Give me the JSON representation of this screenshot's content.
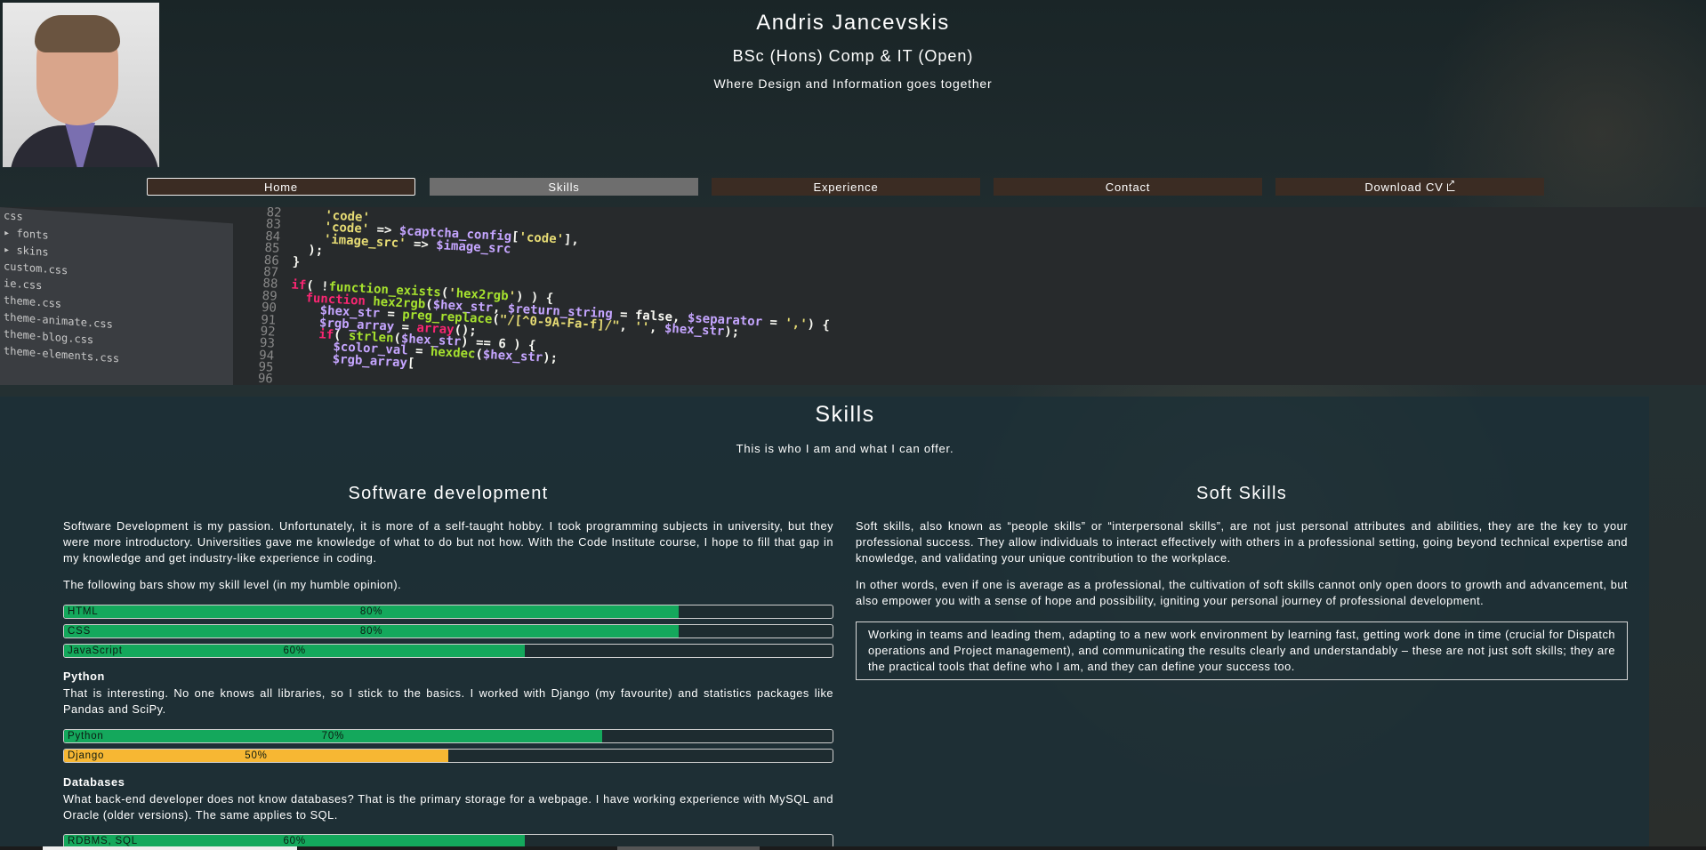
{
  "header": {
    "name": "Andris Jancevskis",
    "degree": "BSc (Hons) Comp & IT (Open)",
    "tagline": "Where Design and Information goes together"
  },
  "nav": {
    "items": [
      {
        "label": "Home"
      },
      {
        "label": "Skills"
      },
      {
        "label": "Experience"
      },
      {
        "label": "Contact"
      },
      {
        "label": "Download CV"
      }
    ],
    "download_icon": "external-link-icon"
  },
  "banner": {
    "tree": [
      "css",
      "▸ fonts",
      "▸ skins",
      "custom.css",
      "ie.css",
      "theme.css",
      "theme-animate.css",
      "theme-blog.css",
      "theme-elements.css"
    ],
    "code": [
      {
        "ln": "82",
        "text": "    'code'  "
      },
      {
        "ln": "83",
        "text": "    'code' => $captcha_config['code'],"
      },
      {
        "ln": "84",
        "text": "    'image_src' => $image_src"
      },
      {
        "ln": "85",
        "text": "  );"
      },
      {
        "ln": "86",
        "text": "}"
      },
      {
        "ln": "87",
        "text": ""
      },
      {
        "ln": "88",
        "text": "if( !function_exists('hex2rgb') ) {"
      },
      {
        "ln": "89",
        "text": "  function hex2rgb($hex_str, $return_string = false, $separator = ',') {"
      },
      {
        "ln": "90",
        "text": "    $hex_str = preg_replace(\"/[^0-9A-Fa-f]/\", '', $hex_str);"
      },
      {
        "ln": "91",
        "text": "    $rgb_array = array();"
      },
      {
        "ln": "92",
        "text": "    if( strlen($hex_str) == 6 ) {"
      },
      {
        "ln": "93",
        "text": "      $color_val = hexdec($hex_str);"
      },
      {
        "ln": "94",
        "text": "      $rgb_array["
      },
      {
        "ln": "95",
        "text": ""
      },
      {
        "ln": "96",
        "text": ""
      }
    ]
  },
  "skills": {
    "title": "Skills",
    "subtitle": "This is who I am and what I can offer.",
    "software": {
      "title": "Software development",
      "intro": "Software Development is my passion. Unfortunately, it is more of a self-taught hobby. I took programming subjects in university, but they were more introductory. Universities gave me knowledge of what to do but not how. With the Code Institute course, I hope to fill that gap in my knowledge and get industry-like experience in coding.",
      "bars_note": "The following bars show my skill level (in my humble opinion).",
      "bars": [
        {
          "label": "HTML",
          "percent_text": "80%",
          "value": 0.8,
          "color": "#14a85c"
        },
        {
          "label": "CSS",
          "percent_text": "80%",
          "value": 0.8,
          "color": "#14a85c"
        },
        {
          "label": "JavaScript",
          "percent_text": "60%",
          "value": 0.6,
          "color": "#14a85c"
        }
      ],
      "python": {
        "heading": "Python",
        "text": "That is interesting. No one knows all libraries, so I stick to the basics. I worked with Django (my favourite) and statistics packages like Pandas and SciPy.",
        "bars": [
          {
            "label": "Python",
            "percent_text": "70%",
            "value": 0.7,
            "color": "#14a85c"
          },
          {
            "label": "Django",
            "percent_text": "50%",
            "value": 0.5,
            "color": "#f7b733"
          }
        ]
      },
      "databases": {
        "heading": "Databases",
        "text": "What back-end developer does not know databases? That is the primary storage for a webpage. I have working experience with MySQL and Oracle (older versions). The same applies to SQL.",
        "bars": [
          {
            "label": "RDBMS, SQL",
            "percent_text": "60%",
            "value": 0.6,
            "color": "#14a85c"
          }
        ]
      }
    },
    "soft": {
      "title": "Soft Skills",
      "p1": "Soft skills, also known as “people skills” or “interpersonal skills”, are not just personal attributes and abilities, they are the key to your professional success. They allow individuals to interact effectively with others in a professional setting, going beyond technical expertise and knowledge, and validating your unique contribution to the workplace.",
      "p2": "In other words, even if one is average as a professional, the cultivation of soft skills cannot only open doors to growth and advancement, but also empower you with a sense of hope and possibility, igniting your personal journey of professional development.",
      "quote": "Working in teams and leading them, adapting to a new work environment by learning fast, getting work done in time (crucial for Dispatch operations and Project management), and communicating the results clearly and understandably – these are not just soft skills; they are the practical tools that define who I am, and they can define your success too."
    }
  }
}
